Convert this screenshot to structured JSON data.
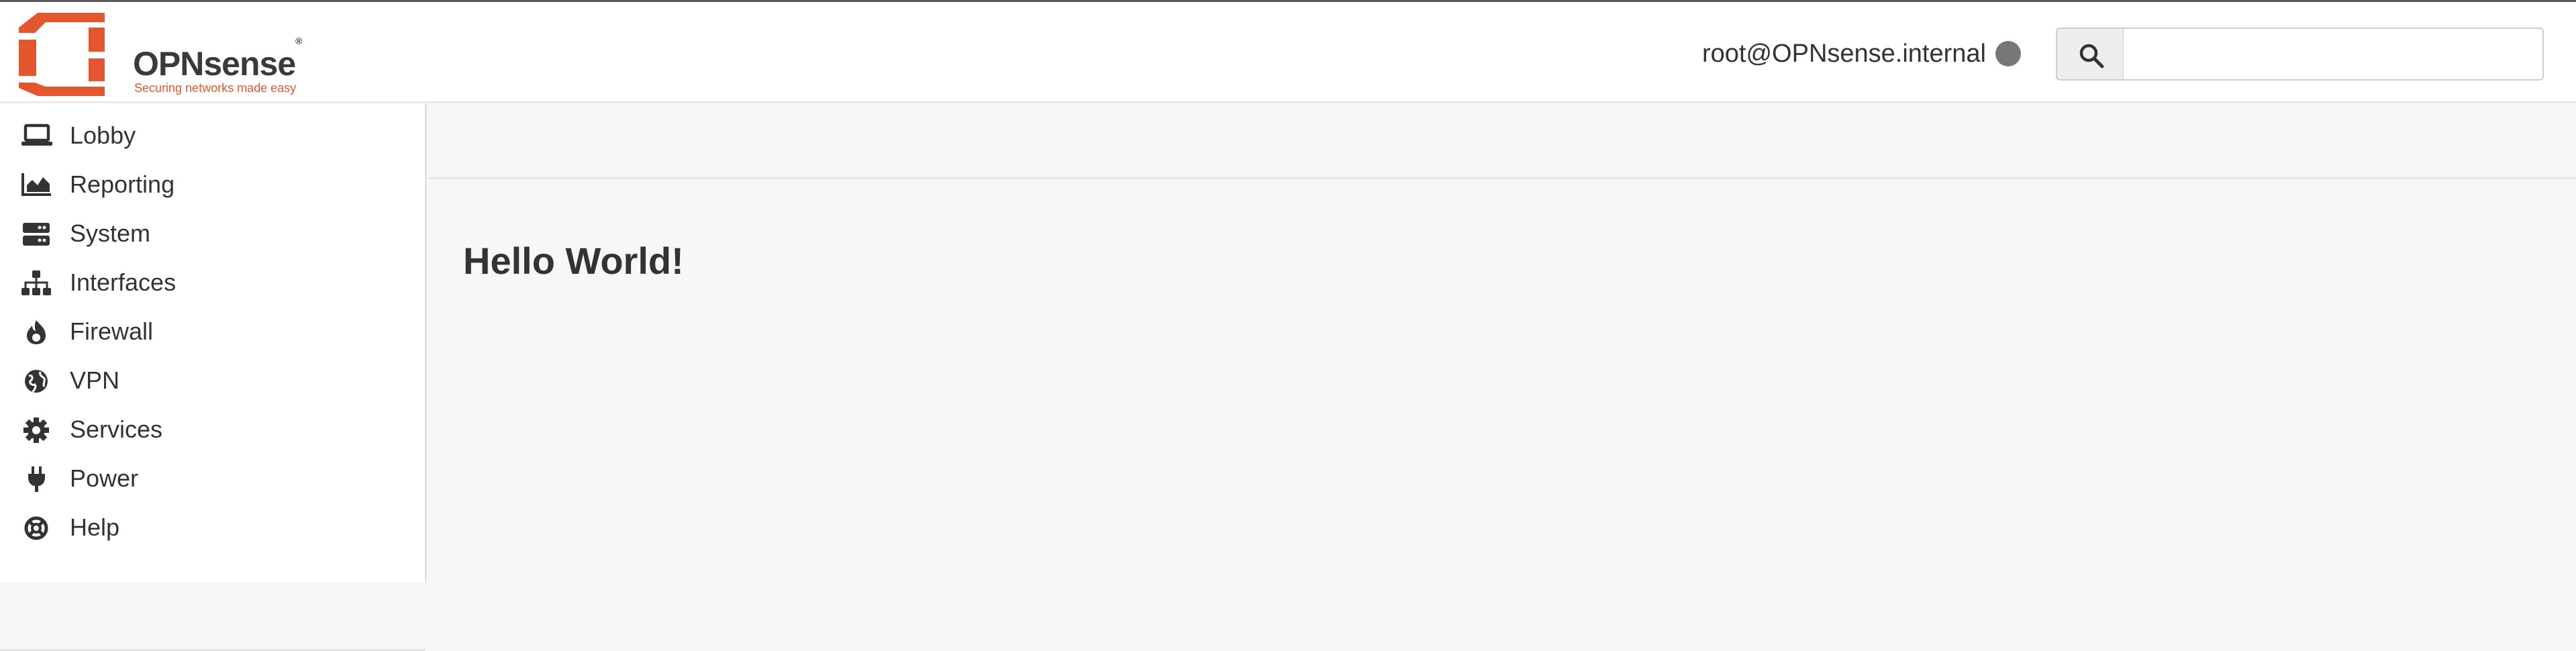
{
  "header": {
    "brand_name": "OPNsense",
    "brand_mark": "®",
    "tagline": "Securing networks made easy",
    "user": "root@OPNsense.internal",
    "search": {
      "value": "",
      "placeholder": ""
    }
  },
  "sidebar": {
    "items": [
      {
        "label": "Lobby",
        "icon": "laptop-icon"
      },
      {
        "label": "Reporting",
        "icon": "area-chart-icon"
      },
      {
        "label": "System",
        "icon": "server-icon"
      },
      {
        "label": "Interfaces",
        "icon": "sitemap-icon"
      },
      {
        "label": "Firewall",
        "icon": "fire-icon"
      },
      {
        "label": "VPN",
        "icon": "globe-icon"
      },
      {
        "label": "Services",
        "icon": "gear-icon"
      },
      {
        "label": "Power",
        "icon": "plug-icon"
      },
      {
        "label": "Help",
        "icon": "lifebuoy-icon"
      }
    ]
  },
  "main": {
    "title": "Hello World!"
  },
  "colors": {
    "brand": "#e4572e",
    "status_dot": "#777777"
  }
}
